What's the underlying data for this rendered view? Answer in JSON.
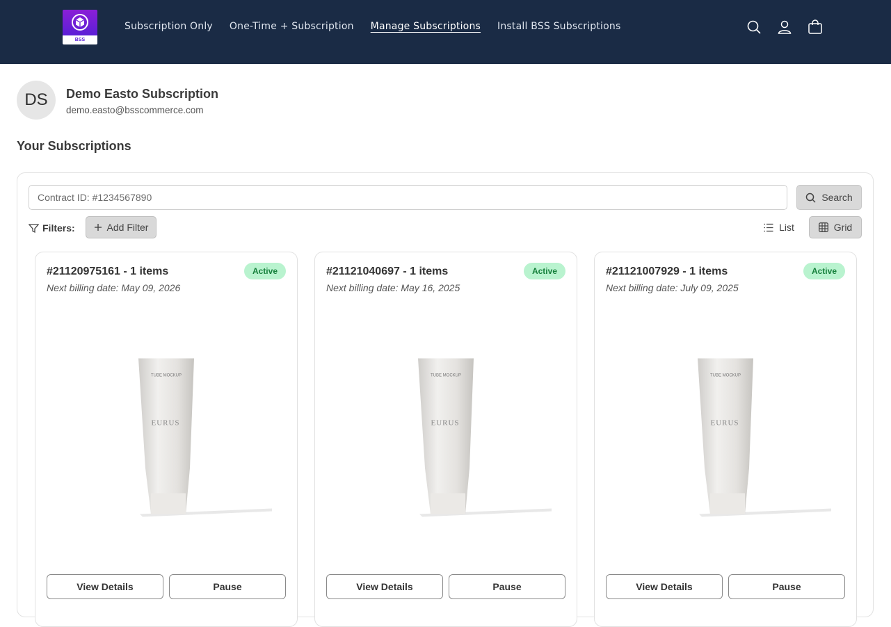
{
  "header": {
    "logo_text": "BSS",
    "nav": [
      {
        "label": "Subscription Only"
      },
      {
        "label": "One-Time + Subscription"
      },
      {
        "label": "Manage Subscriptions"
      },
      {
        "label": "Install BSS Subscriptions"
      }
    ],
    "active_nav": "Manage Subscriptions",
    "icons": [
      "search-icon",
      "account-icon",
      "cart-icon"
    ],
    "background": "#1a2b45"
  },
  "profile": {
    "initials": "DS",
    "name": "Demo Easto Subscription",
    "email": "demo.easto@bsscommerce.com"
  },
  "section_title": "Your Subscriptions",
  "search": {
    "placeholder": "Contract ID: #1234567890",
    "button_label": "Search"
  },
  "filters": {
    "label": "Filters:",
    "add_filter_label": "Add Filter"
  },
  "view_toggle": {
    "list_label": "List",
    "grid_label": "Grid",
    "selected": "Grid"
  },
  "subscriptions": [
    {
      "title": "#21120975161 - 1 items",
      "next_billing": "Next billing date: May 09, 2026",
      "status": "Active",
      "product_brand": "EURUS",
      "product_label": "TUBE MOCKUP",
      "details_label": "View Details",
      "pause_label": "Pause"
    },
    {
      "title": "#21121040697 - 1 items",
      "next_billing": "Next billing date: May 16, 2025",
      "status": "Active",
      "product_brand": "EURUS",
      "product_label": "TUBE MOCKUP",
      "details_label": "View Details",
      "pause_label": "Pause"
    },
    {
      "title": "#21121007929 - 1 items",
      "next_billing": "Next billing date: July 09, 2025",
      "status": "Active",
      "product_brand": "EURUS",
      "product_label": "TUBE MOCKUP",
      "details_label": "View Details",
      "pause_label": "Pause"
    }
  ],
  "colors": {
    "active_badge_bg": "#b9f3cf",
    "active_badge_text": "#16803c"
  }
}
